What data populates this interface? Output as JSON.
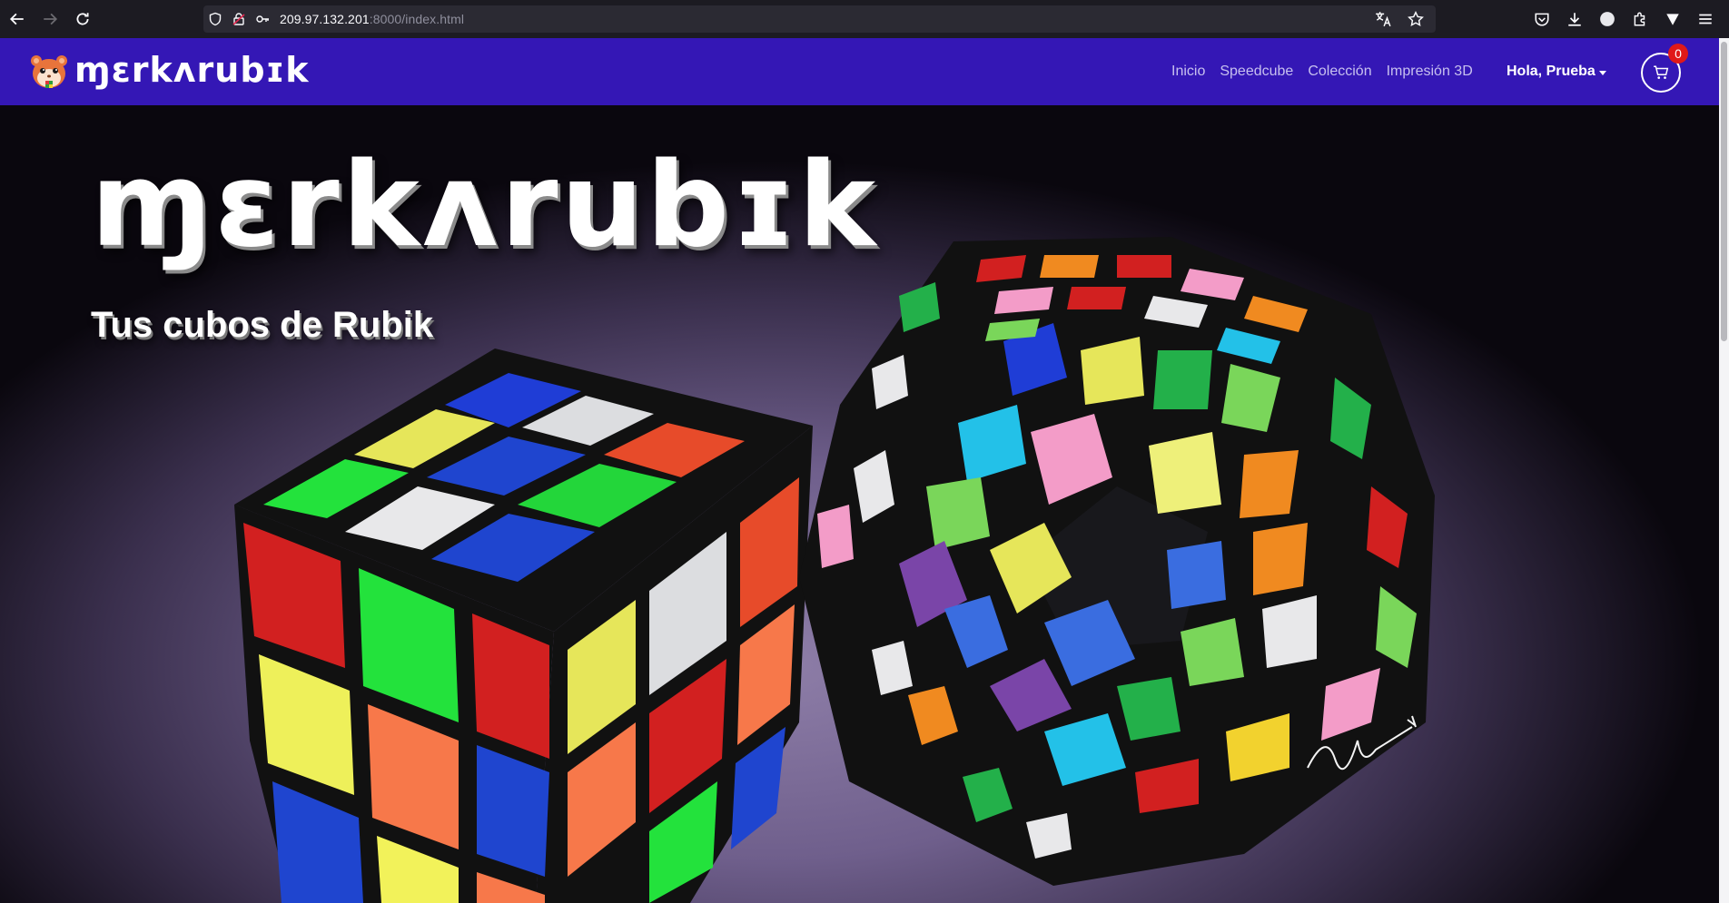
{
  "browser": {
    "url_host": "209.97.132.201",
    "url_path": ":8000/index.html"
  },
  "site": {
    "brand": "ɱɛrkʌrubɪk",
    "menu": [
      "Inicio",
      "Speedcube",
      "Colección",
      "Impresión 3D"
    ],
    "user_greeting": "Hola, Prueba",
    "cart_count": "0",
    "nav_color": "#3417b5"
  },
  "hero": {
    "title": "ɱɛrkʌrubɪk",
    "subtitle": "Tus cubos de Rubik"
  }
}
